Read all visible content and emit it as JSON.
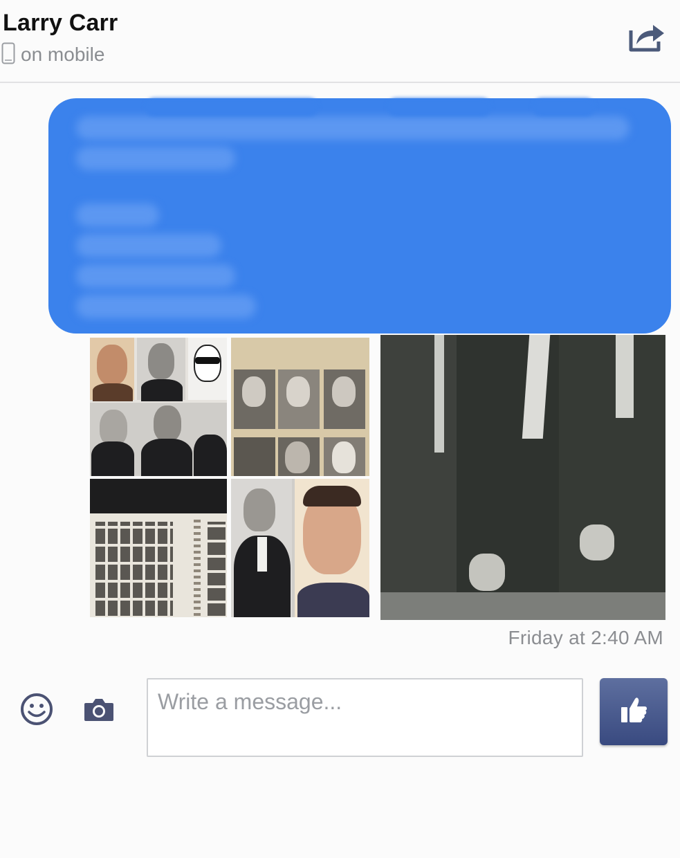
{
  "header": {
    "contact_name": "Larry Carr",
    "presence": "on mobile",
    "presence_icon": "mobile-phone-icon",
    "share_icon": "share-icon"
  },
  "message": {
    "redacted": true,
    "bubble_color": "#3b82ec",
    "images": [
      "Composite of sketches and portraits",
      "Yearbook page with six portraits",
      "Photo of two men in dark suits"
    ],
    "timestamp": "Friday at 2:40 AM"
  },
  "composer": {
    "emoji_icon": "smiley-icon",
    "camera_icon": "camera-icon",
    "placeholder": "Write a message...",
    "like_icon": "thumbs-up-icon",
    "like_color": "#3f5088"
  }
}
